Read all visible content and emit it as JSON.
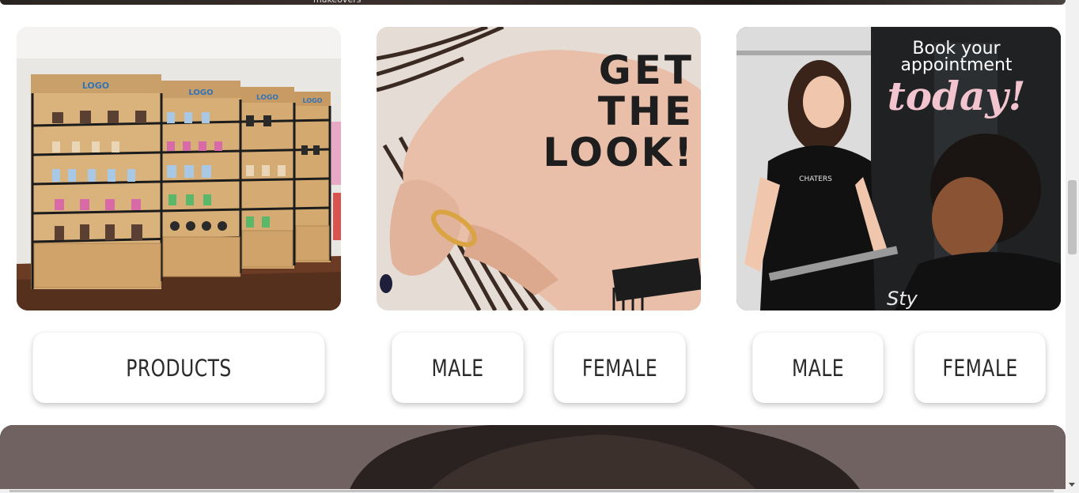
{
  "top_banner": {
    "caption": "makeovers"
  },
  "cards": {
    "products_image": {
      "shelf_labels": [
        "LOGO",
        "LOGO",
        "LOGO",
        "LOGO"
      ]
    },
    "get_the_look": {
      "lines": [
        "GET",
        "THE",
        "LOOK!"
      ]
    },
    "appointment": {
      "line1": "Book your",
      "line2": "appointment",
      "line3": "today!",
      "apron_text": "CHATERS",
      "cape_text": "Sty"
    }
  },
  "buttons": {
    "products": "PRODUCTS",
    "look_male": "MALE",
    "look_female": "FEMALE",
    "appt_male": "MALE",
    "appt_female": "FEMALE"
  },
  "colors": {
    "accent_pink": "#f2c4cf",
    "button_text": "#2b2b2b"
  }
}
